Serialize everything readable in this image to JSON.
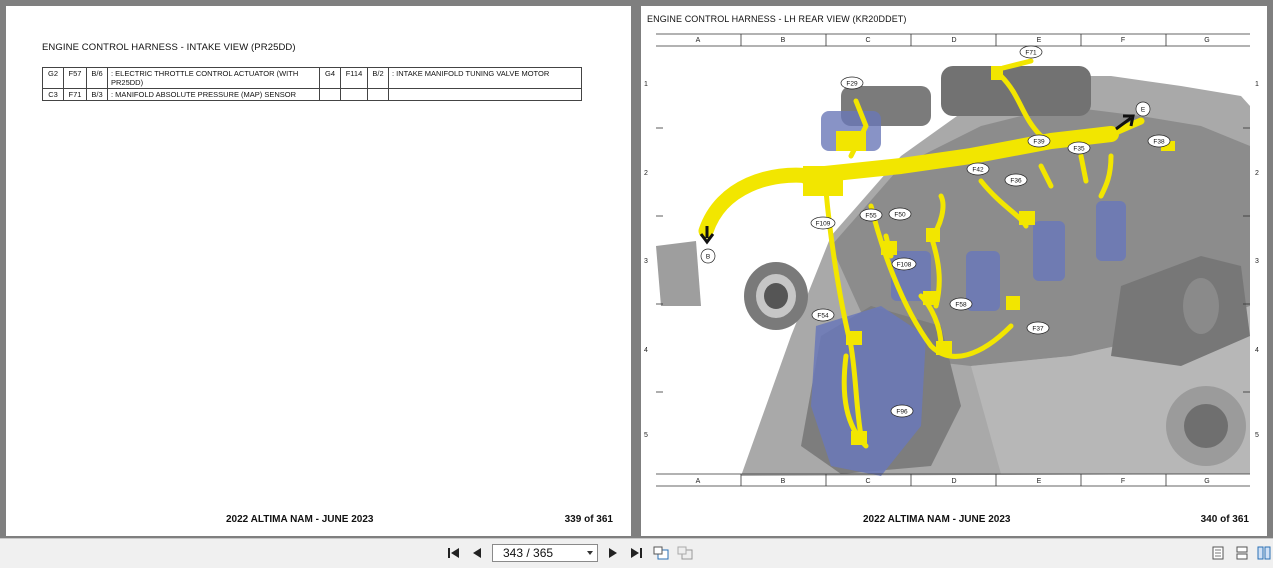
{
  "left_page": {
    "title": "ENGINE CONTROL HARNESS - INTAKE VIEW (PR25DD)",
    "connectors": [
      {
        "grid": "G2",
        "id": "F57",
        "type": "B/6",
        "desc": ": ELECTRIC THROTTLE CONTROL ACTUATOR (WITH PR25DD)",
        "grid2": "G4",
        "id2": "F114",
        "type2": "B/2",
        "desc2": ": INTAKE MANIFOLD TUNING VALVE MOTOR"
      },
      {
        "grid": "C3",
        "id": "F71",
        "type": "B/3",
        "desc": ": MANIFOLD ABSOLUTE PRESSURE (MAP) SENSOR",
        "grid2": "",
        "id2": "",
        "type2": "",
        "desc2": ""
      }
    ],
    "footer_model": "2022 ALTIMA NAM - JUNE 2023",
    "footer_page": "339 of 361"
  },
  "right_page": {
    "title": "ENGINE CONTROL HARNESS - LH REAR VIEW (KR20DDET)",
    "grid_columns": [
      "A",
      "B",
      "C",
      "D",
      "E",
      "F",
      "G"
    ],
    "grid_rows": [
      "1",
      "2",
      "3",
      "4",
      "5"
    ],
    "callouts": [
      "F71",
      "F29",
      "E",
      "F38",
      "F39",
      "F35",
      "F42",
      "F36",
      "F109",
      "F55",
      "F50",
      "B",
      "F108",
      "F58",
      "F54",
      "F37",
      "F96"
    ],
    "footer_model": "2022 ALTIMA NAM - JUNE 2023",
    "footer_page": "340 of 361"
  },
  "toolbar": {
    "current_page": "343 / 365",
    "icons": [
      "first-page-icon",
      "prev-page-icon",
      "next-page-icon",
      "last-page-icon",
      "fit-page-icon",
      "fit-width-icon",
      "single-page-view-icon",
      "continuous-view-icon",
      "two-page-view-icon"
    ]
  },
  "colors": {
    "harness": "#f2e600",
    "components": "#6a78b8",
    "engine": "#9a9a9a",
    "background": "#7f7f7f"
  }
}
